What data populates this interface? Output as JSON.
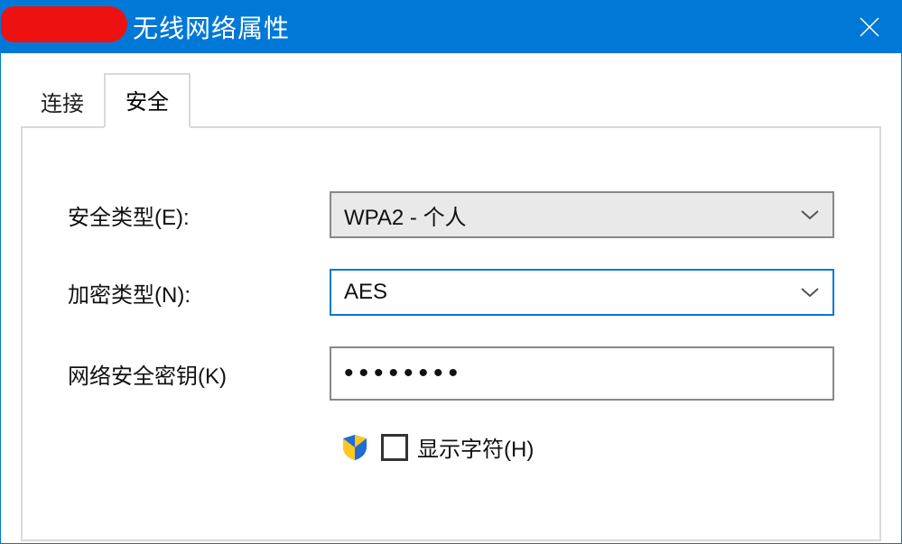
{
  "titlebar": {
    "title": "无线网络属性"
  },
  "tabs": {
    "connect": "连接",
    "security": "安全"
  },
  "form": {
    "security_type_label": "安全类型(E):",
    "security_type_value": "WPA2 - 个人",
    "encryption_type_label": "加密类型(N):",
    "encryption_type_value": "AES",
    "network_key_label": "网络安全密钥(K)",
    "network_key_masked": "••••••••",
    "show_chars_label": "显示字符(H)"
  }
}
